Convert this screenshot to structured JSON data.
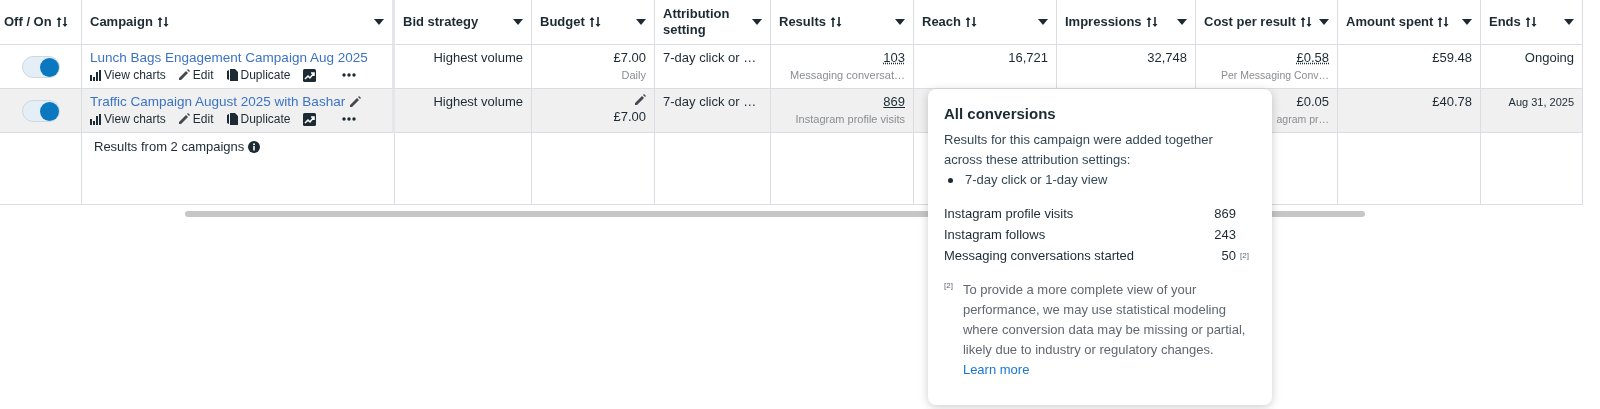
{
  "table": {
    "columns": [
      {
        "label": "Off / On",
        "sortable": true,
        "menu": false
      },
      {
        "label": "Campaign",
        "sortable": true,
        "menu": true
      },
      {
        "label": "Bid strategy",
        "sortable": false,
        "menu": true
      },
      {
        "label": "Budget",
        "sortable": true,
        "menu": true
      },
      {
        "label": "Attribution setting",
        "sortable": false,
        "menu": true
      },
      {
        "label": "Results",
        "sortable": true,
        "menu": true
      },
      {
        "label": "Reach",
        "sortable": true,
        "menu": true
      },
      {
        "label": "Impressions",
        "sortable": true,
        "menu": true
      },
      {
        "label": "Cost per result",
        "sortable": true,
        "menu": true
      },
      {
        "label": "Amount spent",
        "sortable": true,
        "menu": true
      },
      {
        "label": "Ends",
        "sortable": true,
        "menu": true
      }
    ],
    "rows": [
      {
        "on": true,
        "hovered": false,
        "name": "Lunch Bags Engagement Campaign Aug 2025",
        "name_editable": false,
        "actions": [
          {
            "kind": "charts",
            "label": "View charts"
          },
          {
            "kind": "edit",
            "label": "Edit"
          },
          {
            "kind": "duplicate",
            "label": "Duplicate"
          },
          {
            "kind": "insights"
          },
          {
            "kind": "more"
          }
        ],
        "bid_strategy": "Highest volume",
        "budget": {
          "value": "£7.00",
          "period": "Daily",
          "editable": false
        },
        "attribution": "7-day click or …",
        "results": {
          "value": "103",
          "label": "Messaging conversat…"
        },
        "reach": "16,721",
        "impressions": "32,748",
        "cost": {
          "value": "£0.58",
          "label": "Per Messaging Conv…"
        },
        "amount_spent": "£59.48",
        "ends": "Ongoing"
      },
      {
        "on": true,
        "hovered": true,
        "name": "Traffic Campaign August 2025 with Bashar",
        "name_editable": true,
        "actions": [
          {
            "kind": "charts",
            "label": "View charts"
          },
          {
            "kind": "edit",
            "label": "Edit"
          },
          {
            "kind": "duplicate",
            "label": "Duplicate"
          },
          {
            "kind": "insights"
          },
          {
            "kind": "more"
          }
        ],
        "bid_strategy": "Highest volume",
        "budget": {
          "value": "£7.00",
          "editable": true
        },
        "attribution": "7-day click or …",
        "results": {
          "value": "869",
          "label": "Instagram profile visits"
        },
        "cost": {
          "value": "£0.05",
          "label": "agram pr…"
        },
        "amount_spent": "£40.78",
        "ends": "Aug 31, 2025"
      }
    ],
    "summary": {
      "label": "Results from 2 campaigns"
    }
  },
  "popover": {
    "title": "All conversions",
    "intro": "Results for this campaign were added together across these attribution settings:",
    "bullets": [
      "7-day click or 1-day view"
    ],
    "rows": [
      {
        "label": "Instagram profile visits",
        "value": "869"
      },
      {
        "label": "Instagram follows",
        "value": "243"
      },
      {
        "label": "Messaging conversations started",
        "value": "50",
        "note": "[2]"
      }
    ],
    "footnote": {
      "mark": "[2]",
      "text": "To provide a more complete view of your performance, we may use statistical modeling where conversion data may be missing or partial, likely due to industry or regulatory changes.",
      "link": "Learn more"
    }
  }
}
